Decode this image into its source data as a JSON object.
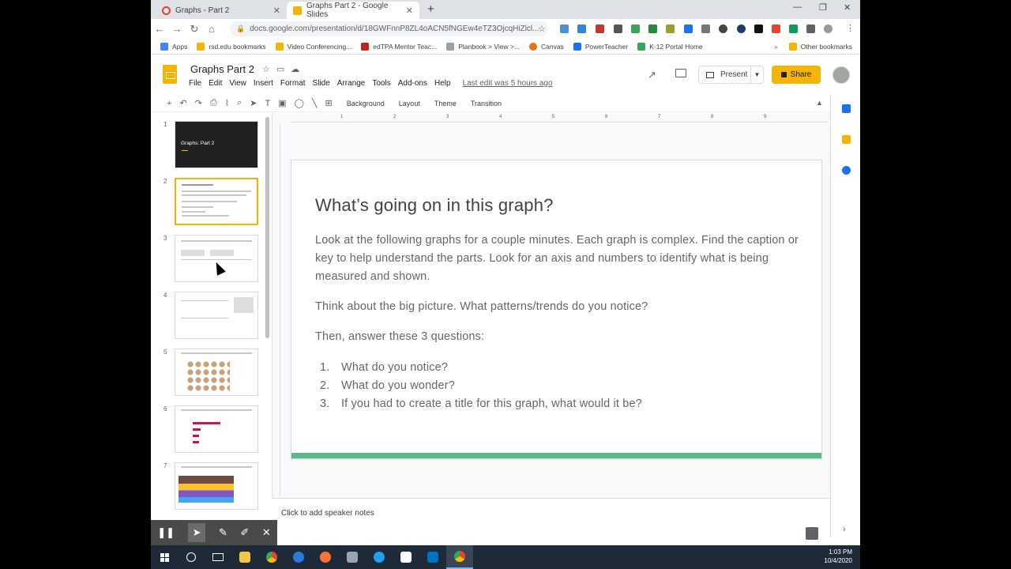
{
  "browser": {
    "tabs": [
      {
        "title": "Graphs - Part 2",
        "active": false,
        "favicon_color": "#db4437"
      },
      {
        "title": "Graphs Part 2 - Google Slides",
        "active": true,
        "favicon_color": "#f4b400"
      }
    ],
    "url": "docs.google.com/presentation/d/18GWFnnP8ZL4oACN5fNGEw4eTZ3OjcqHiZlcl...",
    "bookmarks": [
      {
        "label": "Apps",
        "color": "#4285f4"
      },
      {
        "label": "rsd.edu bookmarks",
        "color": "#f4b400"
      },
      {
        "label": "Video Conferencing...",
        "color": "#f4b400"
      },
      {
        "label": "edTPA Mentor Teac...",
        "color": "#c5221f"
      },
      {
        "label": "Planbook > View >...",
        "color": "#9aa0a6"
      },
      {
        "label": "Canvas",
        "color": "#e8710a"
      },
      {
        "label": "PowerTeacher",
        "color": "#1a73e8"
      },
      {
        "label": "K-12 Portal Home",
        "color": "#34a853"
      }
    ],
    "other_bookmarks": "Other bookmarks"
  },
  "slides": {
    "doc_title": "Graphs Part 2",
    "menu": [
      "File",
      "Edit",
      "View",
      "Insert",
      "Format",
      "Slide",
      "Arrange",
      "Tools",
      "Add-ons",
      "Help"
    ],
    "last_edit": "Last edit was 5 hours ago",
    "present_label": "Present",
    "share_label": "Share",
    "toolbar_text": [
      "Background",
      "Layout",
      "Theme",
      "Transition"
    ],
    "ruler_ticks": [
      "1",
      "2",
      "3",
      "4",
      "5",
      "6",
      "7",
      "8",
      "9"
    ],
    "notes_placeholder": "Click to add speaker notes"
  },
  "filmstrip": {
    "numbers": [
      "1",
      "2",
      "3",
      "4",
      "5",
      "6",
      "7"
    ],
    "slide1_title": "Graphs: Part 2"
  },
  "slide": {
    "title": "What’s going on in this graph?",
    "para1": "Look at the following graphs for a couple minutes.  Each graph is complex.  Find the caption or key to help understand the parts.  Look for an axis and numbers to identify what is being measured and shown.",
    "para2": "Think about the big picture. What patterns/trends do you notice?",
    "para3": "Then, answer these 3 questions:",
    "list": [
      {
        "n": "1.",
        "text": "What do you notice?"
      },
      {
        "n": "2.",
        "text": "What do you wonder?"
      },
      {
        "n": "3.",
        "text": "If you had to create a title for this graph, what would it be?"
      }
    ]
  },
  "taskbar": {
    "time": "1:03 PM",
    "date": "10/4/2020"
  }
}
